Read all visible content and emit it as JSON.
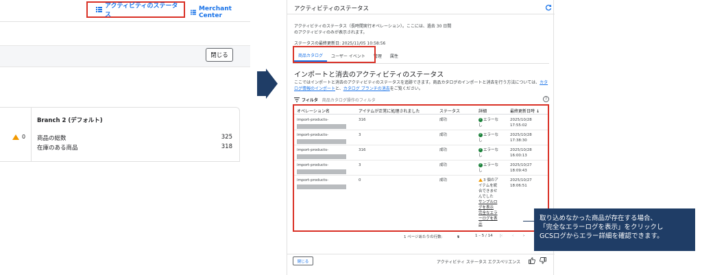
{
  "left": {
    "nav": {
      "activity_status": "アクティビティのステータス",
      "merchant_center": "Merchant Center"
    },
    "close_label": "閉じる",
    "branch_title": "Branch 2 (デフォルト)",
    "warning_count": "0",
    "rows": [
      {
        "label": "商品の総数",
        "value": "325"
      },
      {
        "label": "在庫のある商品",
        "value": "318"
      }
    ]
  },
  "dialog": {
    "title": "アクティビティのステータス",
    "description": "アクティビティのステータス（長時間実行オペレーション）。ここには、過去 30 日間のアクティビティのみが表示されます。",
    "last_updated": "ステータスの最終更新日: 2025/11/05 10:58:56",
    "tabs": [
      {
        "label": "商品カタログ"
      },
      {
        "label": "ユーザー イベント"
      },
      {
        "label": "管理"
      },
      {
        "label": "属性"
      }
    ],
    "section_title": "インポートと消去のアクティビティのステータス",
    "section_desc": {
      "part1": "ここではインポートと消去のアクティビティのステータスを追跡できます。商品カタログのインポートと消去を行う方法については、",
      "link1": "カタログ情報のインポート",
      "part2": "と、",
      "link2": "カタログ ブランチの消去",
      "part3": "をご覧ください。"
    },
    "filter_label": "フィルタ",
    "filter_placeholder": "商品カタログ操作のフィルタ",
    "help_glyph": "?",
    "table": {
      "headers": [
        "オペレーション名",
        "アイテムが正常に処理されました",
        "ステータス",
        "詳細",
        "最終更新日時"
      ],
      "rows": [
        {
          "op": "import-products-",
          "count": "316",
          "status": "成功",
          "detail1": "エラーな",
          "detail2": "し",
          "date": "2025/10/28",
          "time": "17:55:02"
        },
        {
          "op": "import-products-",
          "count": "3",
          "status": "成功",
          "detail1": "エラーな",
          "detail2": "し",
          "date": "2025/10/28",
          "time": "17:38:30"
        },
        {
          "op": "import-products-",
          "count": "316",
          "status": "成功",
          "detail1": "エラーな",
          "detail2": "し",
          "date": "2025/10/28",
          "time": "16:00:13"
        },
        {
          "op": "import-products-",
          "count": "3",
          "status": "成功",
          "detail1": "エラーな",
          "detail2": "し",
          "date": "2025/10/27",
          "time": "18:09:43"
        },
        {
          "op": "import-products-",
          "count": "0",
          "status": "成功",
          "warn_lines": [
            "3 個のア",
            "イテムを統",
            "合できませ",
            "んでした"
          ],
          "link_sample": [
            "サンプルロ",
            "グを表示"
          ],
          "link_full": [
            "完全なエラ",
            "ーログを表",
            "示"
          ],
          "date": "2025/10/27",
          "time": "18:06:51"
        }
      ]
    },
    "pager": {
      "rows_per_page_label": "1 ページあたりの行数:",
      "rows_per_page": "5",
      "range": "1 – 5 / 14"
    },
    "close_label": "閉じる",
    "feedback_label": "アクティビティ ステータス エクスペリエンス"
  },
  "callout": {
    "lines": [
      "取り込めなかった商品が存在する場合、",
      "「完全なエラーログを表示」をクリックし",
      "GCSログからエラー詳細を確認できます。"
    ]
  },
  "colors": {
    "accent": "#1a73e8",
    "highlight": "#d93025",
    "callout_bg": "#1f3d66",
    "success": "#188038",
    "warning": "#f29900"
  }
}
